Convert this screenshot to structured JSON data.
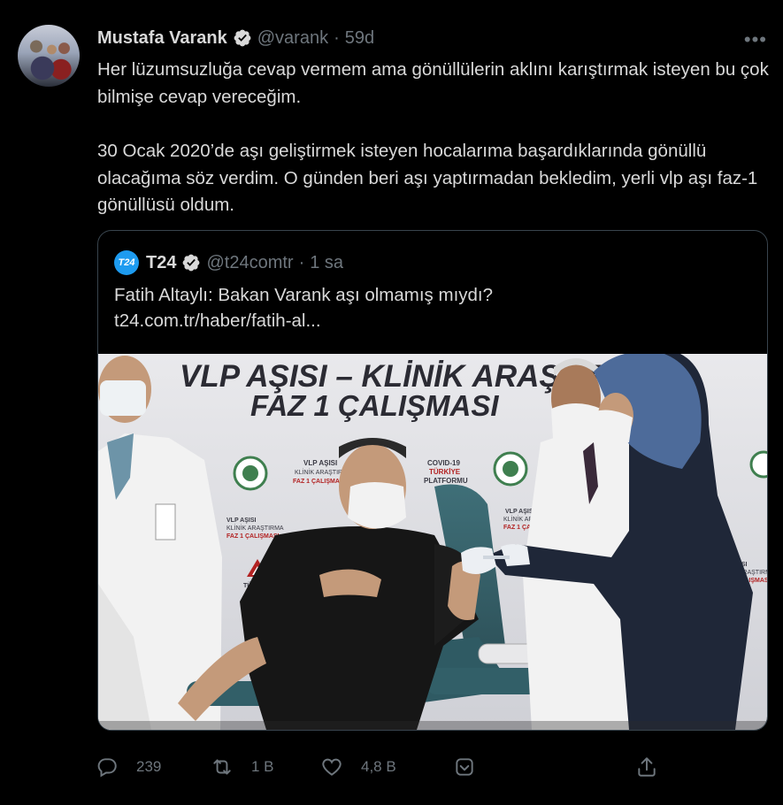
{
  "tweet": {
    "author_name": "Mustafa Varank",
    "author_handle": "@varank",
    "time_separator": "·",
    "time": "59d",
    "more_label": "•••",
    "paragraphs": [
      "Her lüzumsuzluğa cevap vermem ama gönüllülerin aklını karıştırmak isteyen bu çok bilmişe cevap vereceğim.",
      "30 Ocak 2020’de aşı geliştirmek isteyen hocalarıma başardıklarında gönüllü olacağıma söz verdim. O günden beri aşı yaptırmadan bekledim, yerli vlp aşı faz-1 gönüllüsü oldum."
    ]
  },
  "quoted": {
    "logo_text": "T24",
    "author_name": "T24",
    "author_handle": "@t24comtr",
    "time_separator": "·",
    "time": "1 sa",
    "text": "Fatih Altaylı: Bakan Varank aşı olmamış mıydı?",
    "link": "t24.com.tr/haber/fatih-al...",
    "image": {
      "banner_line1": "VLP AŞISI – KLİNİK ARAŞTIRMA",
      "banner_line2": "FAZ 1 ÇALIŞMASI",
      "small_label1": "VLP AŞISI",
      "small_label2": "KLİNİK ARAŞTIRMA",
      "small_label3": "FAZ 1 ÇALIŞMASI",
      "covid_label1": "COVID-19",
      "covid_label2": "TÜRKİYE",
      "covid_label3": "PLATFORMU",
      "tubitak_label": "TÜBİTAK"
    }
  },
  "actions": {
    "reply_count": "239",
    "retweet_count": "1 B",
    "like_count": "4,8 B"
  },
  "colors": {
    "background": "#000000",
    "text": "#d9d9d9",
    "muted": "#6e767d",
    "border": "#38444d",
    "verified": "#d9d9d9"
  }
}
